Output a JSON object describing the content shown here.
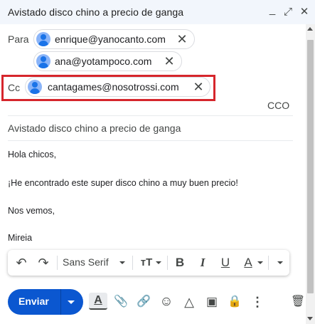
{
  "window": {
    "title": "Avistado disco chino a precio de ganga",
    "minimize_symbol": "_",
    "expand_symbol": "⤢",
    "close_symbol": "✕"
  },
  "recipients": {
    "to_label": "Para",
    "to": [
      "enrique@yanocanto.com",
      "ana@yotampoco.com"
    ],
    "cc_label": "Cc",
    "cc": [
      "cantagames@nosotrossi.com"
    ],
    "remove_symbol": "✕",
    "bcc_label": "CCO"
  },
  "subject": "Avistado disco chino a precio de ganga",
  "body": {
    "lines": [
      "Hola chicos,",
      "¡He encontrado este super disco chino a muy buen precio!",
      "Nos vemos,",
      "Mireia"
    ]
  },
  "format_bar": {
    "undo_symbol": "↶",
    "redo_symbol": "↷",
    "font_name": "Sans Serif",
    "text_size_symbol": "тT",
    "bold_symbol": "B",
    "italic_symbol": "I",
    "underline_symbol": "U",
    "text_color_symbol": "A"
  },
  "actions": {
    "send_label": "Enviar",
    "format_symbol": "A",
    "attach_symbol": "📎",
    "link_symbol": "🔗",
    "emoji_symbol": "☺",
    "drive_symbol": "△",
    "photo_symbol": "▣",
    "confidential_symbol": "🔒",
    "more_symbol": "⋮",
    "discard_symbol": "🗑"
  },
  "colors": {
    "accent": "#0b57d0",
    "highlight_border": "#d6262c",
    "titlebar_bg": "#f2f6fc"
  }
}
